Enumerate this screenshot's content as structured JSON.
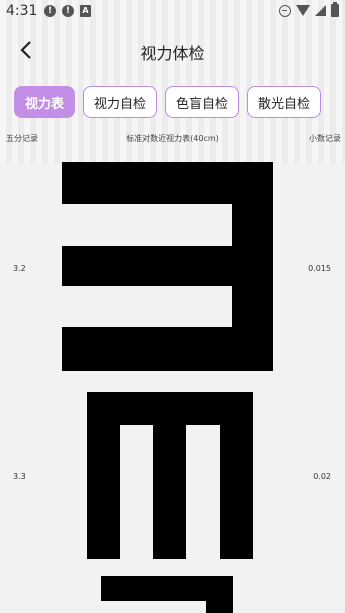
{
  "status_bar": {
    "time": "4:31",
    "icons_left": [
      "alert-icon",
      "alert-icon",
      "a-icon"
    ],
    "icons_right": [
      "dnd-icon",
      "wifi-icon",
      "signal-icon",
      "battery-icon"
    ]
  },
  "header": {
    "title": "视力体检",
    "back_icon": "chevron-left-icon"
  },
  "tabs": [
    {
      "label": "视力表",
      "active": true
    },
    {
      "label": "视力自检",
      "active": false
    },
    {
      "label": "色盲自检",
      "active": false
    },
    {
      "label": "散光自检",
      "active": false
    }
  ],
  "chart": {
    "left_header": "五分记录",
    "center_header": "标准对数近视力表(40cm)",
    "right_header": "小数记录",
    "rows": [
      {
        "five_point": "3.2",
        "decimal": "0.015",
        "direction": "left"
      },
      {
        "five_point": "3.3",
        "decimal": "0.02",
        "direction": "down"
      }
    ]
  },
  "colors": {
    "accent": "#c38fe6",
    "tab_border": "#b98ee0",
    "optotype": "#000000"
  }
}
